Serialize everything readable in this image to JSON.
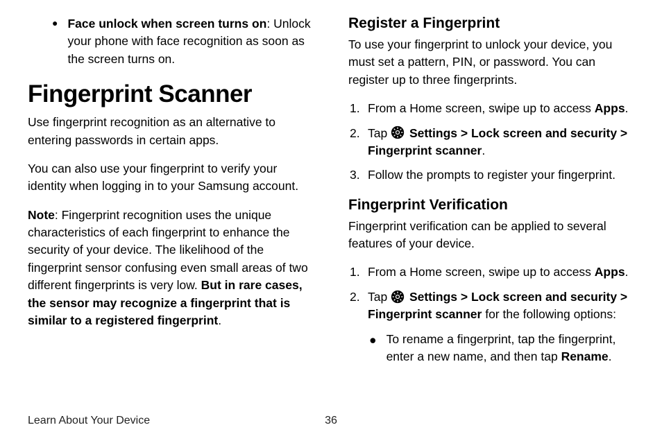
{
  "left": {
    "bullet": {
      "bold": "Face unlock when screen turns on",
      "rest": ": Unlock your phone with face recognition as soon as the screen turns on."
    },
    "heading": "Fingerprint Scanner",
    "p1": "Use fingerprint recognition as an alternative to entering passwords in certain apps.",
    "p2": "You can also use your fingerprint to verify your identity when logging in to your Samsung account.",
    "note_label": "Note",
    "note_body": ": Fingerprint recognition uses the unique characteristics of each fingerprint to enhance the security of your device. The likelihood of the fingerprint sensor confusing even small areas of two different fingerprints is very low. ",
    "note_bold": "But in rare cases, the sensor may recognize a fingerprint that is similar to a registered fingerprint",
    "note_end": "."
  },
  "right": {
    "register": {
      "heading": "Register a Fingerprint",
      "intro": "To use your fingerprint to unlock your device, you must set a pattern, PIN, or password. You can register up to three fingerprints.",
      "step1_pre": "From a Home screen, swipe up to access ",
      "step1_bold": "Apps",
      "step1_post": ".",
      "step2_pre": "Tap ",
      "step2_settings": "Settings",
      "step2_chev1": " > ",
      "step2_lock": "Lock screen and security",
      "step2_chev2": " > ",
      "step2_fp": "Fingerprint scanner",
      "step2_post": ".",
      "step3": "Follow the prompts to register your fingerprint."
    },
    "verify": {
      "heading": "Fingerprint Verification",
      "intro": "Fingerprint verification can be applied to several features of your device.",
      "step1_pre": "From a Home screen, swipe up to access ",
      "step1_bold": "Apps",
      "step1_post": ".",
      "step2_pre": "Tap ",
      "step2_settings": "Settings",
      "step2_chev1": " > ",
      "step2_lock": "Lock screen and security",
      "step2_chev2": " > ",
      "step2_fp": "Fingerprint scanner",
      "step2_post": " for the following options:",
      "sub_pre": "To rename a fingerprint, tap the fingerprint, enter a new name, and then tap ",
      "sub_bold": "Rename",
      "sub_post": "."
    }
  },
  "footer": {
    "left": "Learn About Your Device",
    "page": "36"
  }
}
